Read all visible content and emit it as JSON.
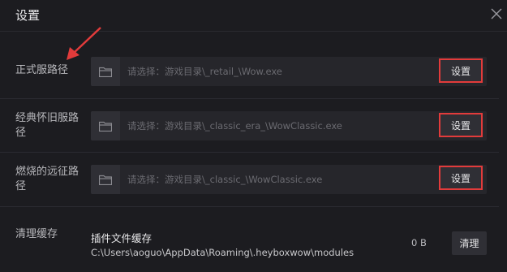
{
  "window": {
    "title": "设置"
  },
  "settings": [
    {
      "label": "正式服路径",
      "placeholder": "请选择：游戏目录\\_retail_\\Wow.exe",
      "button": "设置"
    },
    {
      "label": "经典怀旧服路径",
      "placeholder": "请选择：游戏目录\\_classic_era_\\WowClassic.exe",
      "button": "设置"
    },
    {
      "label": "燃烧的远征路径",
      "placeholder": "请选择：游戏目录\\_classic_\\WowClassic.exe",
      "button": "设置"
    }
  ],
  "cache": {
    "label": "清理缓存",
    "title": "插件文件缓存",
    "path": "C:\\Users\\aoguo\\AppData\\Roaming\\.heyboxwow\\modules",
    "size": "0 B",
    "button": "清理"
  },
  "colors": {
    "highlight": "#e23b3b",
    "background": "#1c1c20"
  },
  "icons": {
    "folder": "folder-icon",
    "close": "close-icon",
    "annotation": "red-arrow-annotation"
  }
}
